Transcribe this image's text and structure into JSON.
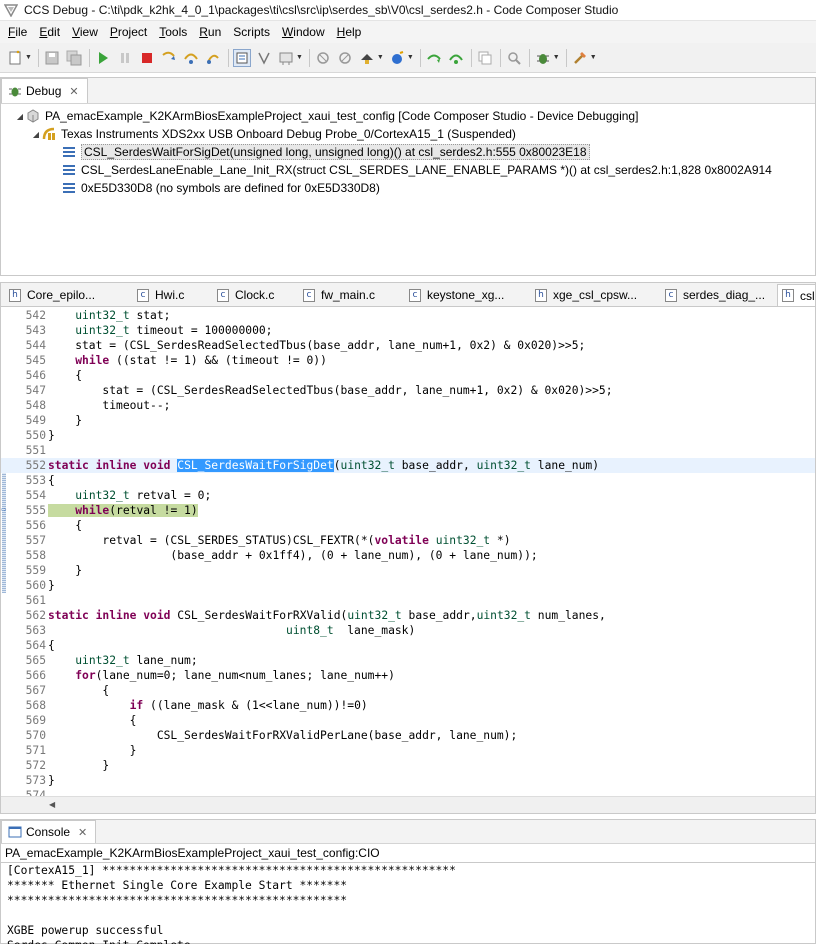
{
  "window": {
    "title": "CCS Debug - C:\\ti\\pdk_k2hk_4_0_1\\packages\\ti\\csl\\src\\ip\\serdes_sb\\V0\\csl_serdes2.h - Code Composer Studio"
  },
  "menubar": {
    "items": [
      {
        "label": "File",
        "mnemonic": "F",
        "rest": "ile"
      },
      {
        "label": "Edit",
        "mnemonic": "E",
        "rest": "dit"
      },
      {
        "label": "View",
        "mnemonic": "V",
        "rest": "iew"
      },
      {
        "label": "Project",
        "mnemonic": "P",
        "rest": "roject"
      },
      {
        "label": "Tools",
        "mnemonic": "T",
        "rest": "ools"
      },
      {
        "label": "Run",
        "mnemonic": "R",
        "rest": "un"
      },
      {
        "label": "Scripts",
        "mnemonic": "",
        "rest": "Scripts"
      },
      {
        "label": "Window",
        "mnemonic": "W",
        "rest": "indow"
      },
      {
        "label": "Help",
        "mnemonic": "H",
        "rest": "elp"
      }
    ]
  },
  "toolbar": {
    "icons": [
      "new-icon",
      "save-icon",
      "save-all-icon",
      "resume-icon",
      "suspend-icon",
      "terminate-icon",
      "step-into-icon",
      "step-over-icon",
      "step-return-icon",
      "instruction-stepping-icon",
      "reset-icon",
      "restart-icon",
      "connect-icon",
      "disconnect-icon",
      "load-program-icon",
      "run-last-icon",
      "profile-icon",
      "assembly-step-into-icon",
      "assembly-step-over-icon",
      "copy-icon",
      "search-icon",
      "debug-icon",
      "external-tools-icon"
    ]
  },
  "debug_view": {
    "tab_label": "Debug",
    "tree": [
      {
        "label": "PA_emacExample_K2KArmBiosExampleProject_xaui_test_config [Code Composer Studio - Device Debugging]",
        "icon": "launch-icon"
      },
      {
        "label": "Texas Instruments XDS2xx USB Onboard Debug Probe_0/CortexA15_1 (Suspended)",
        "icon": "thread-icon"
      },
      {
        "label": "CSL_SerdesWaitForSigDet(unsigned long, unsigned long)() at csl_serdes2.h:555 0x80023E18",
        "icon": "stack-frame-icon",
        "selected": true
      },
      {
        "label": "CSL_SerdesLaneEnable_Lane_Init_RX(struct CSL_SERDES_LANE_ENABLE_PARAMS *)() at csl_serdes2.h:1,828 0x8002A914",
        "icon": "stack-frame-icon"
      },
      {
        "label": "0xE5D330D8  (no symbols are defined for 0xE5D330D8)",
        "icon": "stack-frame-icon"
      }
    ]
  },
  "editor": {
    "tabs": [
      {
        "label": "Core_epilo...",
        "icon": "h"
      },
      {
        "label": "Hwi.c",
        "icon": "c"
      },
      {
        "label": "Clock.c",
        "icon": "c"
      },
      {
        "label": "fw_main.c",
        "icon": "c"
      },
      {
        "label": "keystone_xg...",
        "icon": "c"
      },
      {
        "label": "xge_csl_cpsw...",
        "icon": "h"
      },
      {
        "label": "serdes_diag_...",
        "icon": "c"
      },
      {
        "label": "csl",
        "icon": "h"
      }
    ],
    "lines": [
      {
        "n": "542",
        "t": "    uint32_t stat;"
      },
      {
        "n": "543",
        "t": "    uint32_t timeout = 100000000;"
      },
      {
        "n": "544",
        "t": "    stat = (CSL_SerdesReadSelectedTbus(base_addr, lane_num+1, 0x2) & 0x020)>>5;"
      },
      {
        "n": "545",
        "t": "    while ((stat != 1) && (timeout != 0))"
      },
      {
        "n": "546",
        "t": "    {"
      },
      {
        "n": "547",
        "t": "        stat = (CSL_SerdesReadSelectedTbus(base_addr, lane_num+1, 0x2) & 0x020)>>5;"
      },
      {
        "n": "548",
        "t": "        timeout--;"
      },
      {
        "n": "549",
        "t": "    }"
      },
      {
        "n": "550",
        "t": "}"
      },
      {
        "n": "551",
        "t": ""
      },
      {
        "n": "552",
        "t": "static inline void CSL_SerdesWaitForSigDet(uint32_t base_addr, uint32_t lane_num)"
      },
      {
        "n": "553",
        "t": "{"
      },
      {
        "n": "554",
        "t": "    uint32_t retval = 0;"
      },
      {
        "n": "555",
        "t": "    while(retval != 1)"
      },
      {
        "n": "556",
        "t": "    {"
      },
      {
        "n": "557",
        "t": "        retval = (CSL_SERDES_STATUS)CSL_FEXTR(*(volatile uint32_t *)"
      },
      {
        "n": "558",
        "t": "                  (base_addr + 0x1ff4), (0 + lane_num), (0 + lane_num));"
      },
      {
        "n": "559",
        "t": "    }"
      },
      {
        "n": "560",
        "t": "}"
      },
      {
        "n": "561",
        "t": ""
      },
      {
        "n": "562",
        "t": "static inline void CSL_SerdesWaitForRXValid(uint32_t base_addr,uint32_t num_lanes,"
      },
      {
        "n": "563",
        "t": "                                   uint8_t  lane_mask)"
      },
      {
        "n": "564",
        "t": "{"
      },
      {
        "n": "565",
        "t": "    uint32_t lane_num;"
      },
      {
        "n": "566",
        "t": "    for(lane_num=0; lane_num<num_lanes; lane_num++)"
      },
      {
        "n": "567",
        "t": "        {"
      },
      {
        "n": "568",
        "t": "            if ((lane_mask & (1<<lane_num))!=0)"
      },
      {
        "n": "569",
        "t": "            {"
      },
      {
        "n": "570",
        "t": "                CSL_SerdesWaitForRXValidPerLane(base_addr, lane_num);"
      },
      {
        "n": "571",
        "t": "            }"
      },
      {
        "n": "572",
        "t": "        }"
      },
      {
        "n": "573",
        "t": "}"
      },
      {
        "n": "574",
        "t": ""
      }
    ]
  },
  "console": {
    "tab_label": "Console",
    "subtitle": "PA_emacExample_K2KArmBiosExampleProject_xaui_test_config:CIO",
    "lines": [
      "[CortexA15_1] ****************************************************",
      "******* Ethernet Single Core Example Start *******",
      "**************************************************",
      "",
      "XGBE powerup successful",
      "Serdes Common Init Complete"
    ]
  }
}
